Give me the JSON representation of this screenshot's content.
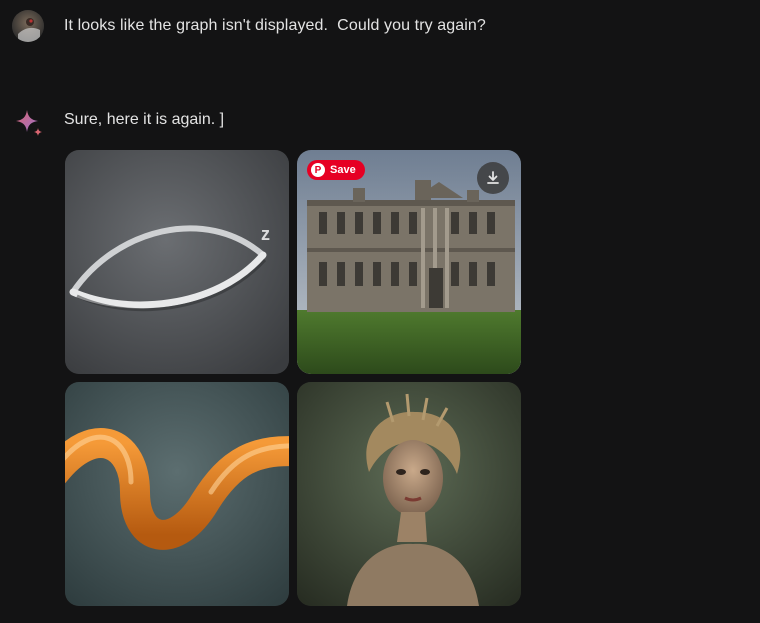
{
  "user_message": {
    "text": "It looks like the graph isn't displayed.  Could you try again?"
  },
  "assistant_reply": {
    "text": "Sure, here it is again. ]"
  },
  "images": [
    {
      "id": "tile-1",
      "subject": "white curved lens shape with z"
    },
    {
      "id": "tile-2",
      "subject": "stone mansion on lawn",
      "overlay": {
        "save_label": "Save"
      }
    },
    {
      "id": "tile-3",
      "subject": "orange wavy tube"
    },
    {
      "id": "tile-4",
      "subject": "portrait of woman"
    }
  ],
  "colors": {
    "background": "#131314",
    "text": "#e3e3e3",
    "pinterest_red": "#e60023"
  }
}
